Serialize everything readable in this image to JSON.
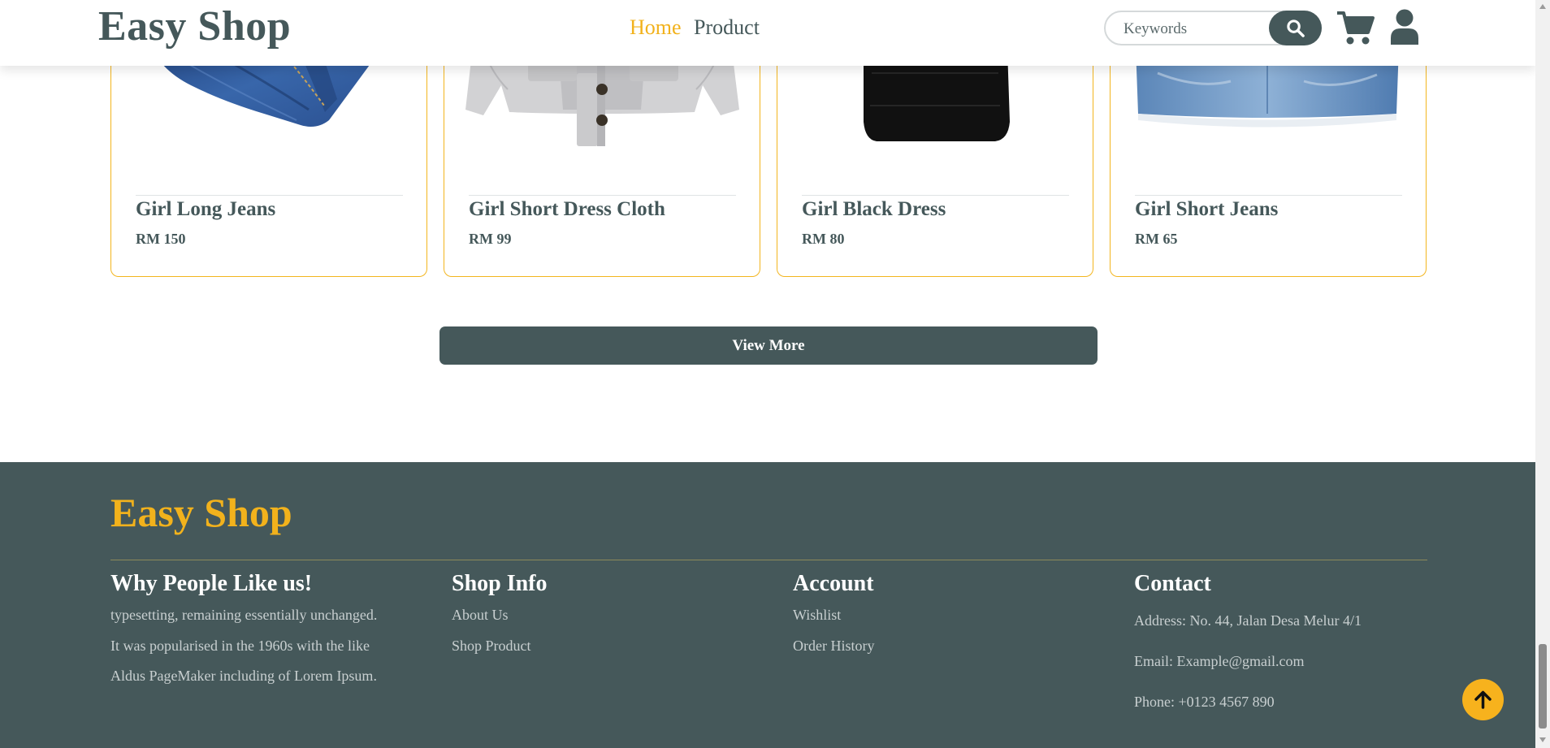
{
  "header": {
    "brand": "Easy Shop",
    "nav": [
      {
        "label": "Home",
        "active": true
      },
      {
        "label": "Product",
        "active": false
      }
    ],
    "search": {
      "placeholder": "Keywords",
      "button_icon": "search-icon"
    },
    "icons": [
      "cart-icon",
      "user-icon"
    ]
  },
  "products": [
    {
      "name": "Girl Long Jeans",
      "price": "RM 150",
      "image": "jeans"
    },
    {
      "name": "Girl Short Dress Cloth",
      "price": "RM 99",
      "image": "knit-cardigan"
    },
    {
      "name": "Girl Black Dress",
      "price": "RM 80",
      "image": "black-dress"
    },
    {
      "name": "Girl Short Jeans",
      "price": "RM 65",
      "image": "denim-skirt"
    }
  ],
  "view_more_label": "View More",
  "footer": {
    "brand": "Easy Shop",
    "why": {
      "heading": "Why People Like us!",
      "lines": [
        "typesetting, remaining essentially unchanged.",
        "It was popularised in the 1960s with the like",
        "Aldus PageMaker including of Lorem Ipsum."
      ]
    },
    "shop_info": {
      "heading": "Shop Info",
      "links": [
        "About Us",
        "Shop Product"
      ]
    },
    "account": {
      "heading": "Account",
      "links": [
        "Wishlist",
        "Order History"
      ]
    },
    "contact": {
      "heading": "Contact",
      "address": "Address: No. 44, Jalan Desa Melur 4/1",
      "email": "Email: Example@gmail.com",
      "phone": "Phone: +0123 4567 890"
    }
  },
  "colors": {
    "primary": "#45585a",
    "accent": "#f2b21c",
    "card_border": "#f3b51e",
    "footer_bg": "#45585a"
  }
}
